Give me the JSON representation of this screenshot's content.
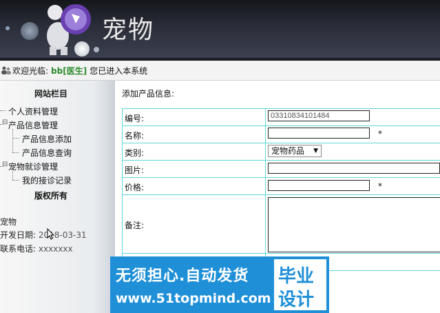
{
  "header": {
    "title": "宠物"
  },
  "welcome": {
    "prefix": "欢迎光临:",
    "user": "bb[医生]",
    "suffix": "您已进入本系统"
  },
  "sidebar": {
    "title": "网站栏目",
    "items": [
      {
        "label": "个人资料管理"
      },
      {
        "label": "产品信息管理"
      },
      {
        "label": "产品信息添加"
      },
      {
        "label": "产品信息查询"
      },
      {
        "label": "宠物就诊管理"
      },
      {
        "label": "我的接诊记录"
      }
    ],
    "copyright": "版权所有",
    "site_name": "宠物",
    "dev_date_label": "开发日期:",
    "dev_date": "2018-03-31",
    "phone_label": "联系电话:",
    "phone": "xxxxxxx"
  },
  "main": {
    "caption": "添加产品信息:",
    "fields": {
      "code_label": "编号:",
      "code_value": "03310834101484",
      "name_label": "名称:",
      "name_value": "",
      "category_label": "类别:",
      "category_value": "宠物药品",
      "image_label": "图片:",
      "image_value": "",
      "price_label": "价格:",
      "price_value": "",
      "note_label": "备注:",
      "required_mark": "*"
    }
  },
  "watermark": {
    "line1": "无须担心.自动发货",
    "line2": "www.51topmind.com",
    "box_line1": "毕业",
    "box_line2": "设计"
  }
}
